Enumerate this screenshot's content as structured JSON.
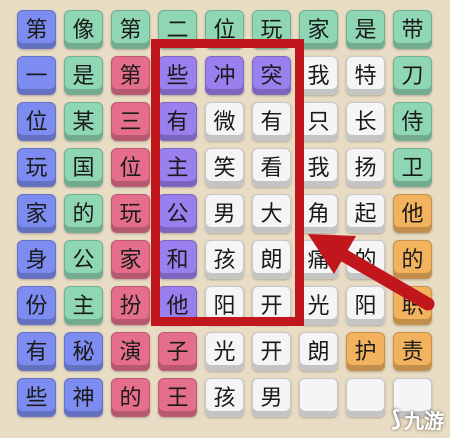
{
  "grid": {
    "rows": [
      [
        {
          "ch": "第",
          "color": "blue"
        },
        {
          "ch": "像",
          "color": "green"
        },
        {
          "ch": "第",
          "color": "green"
        },
        {
          "ch": "二",
          "color": "green"
        },
        {
          "ch": "位",
          "color": "green"
        },
        {
          "ch": "玩",
          "color": "green"
        },
        {
          "ch": "家",
          "color": "green"
        },
        {
          "ch": "是",
          "color": "green"
        },
        {
          "ch": "带",
          "color": "green"
        }
      ],
      [
        {
          "ch": "一",
          "color": "blue"
        },
        {
          "ch": "是",
          "color": "green"
        },
        {
          "ch": "第",
          "color": "pink"
        },
        {
          "ch": "些",
          "color": "purple"
        },
        {
          "ch": "冲",
          "color": "purple"
        },
        {
          "ch": "突",
          "color": "purple"
        },
        {
          "ch": "我",
          "color": "white"
        },
        {
          "ch": "特",
          "color": "white"
        },
        {
          "ch": "刀",
          "color": "green"
        }
      ],
      [
        {
          "ch": "位",
          "color": "blue"
        },
        {
          "ch": "某",
          "color": "green"
        },
        {
          "ch": "三",
          "color": "pink"
        },
        {
          "ch": "有",
          "color": "purple"
        },
        {
          "ch": "微",
          "color": "white"
        },
        {
          "ch": "有",
          "color": "white"
        },
        {
          "ch": "只",
          "color": "white"
        },
        {
          "ch": "长",
          "color": "white"
        },
        {
          "ch": "侍",
          "color": "green"
        }
      ],
      [
        {
          "ch": "玩",
          "color": "blue"
        },
        {
          "ch": "国",
          "color": "green"
        },
        {
          "ch": "位",
          "color": "pink"
        },
        {
          "ch": "主",
          "color": "purple"
        },
        {
          "ch": "笑",
          "color": "white"
        },
        {
          "ch": "看",
          "color": "white"
        },
        {
          "ch": "我",
          "color": "white"
        },
        {
          "ch": "扬",
          "color": "white"
        },
        {
          "ch": "卫",
          "color": "green"
        }
      ],
      [
        {
          "ch": "家",
          "color": "blue"
        },
        {
          "ch": "的",
          "color": "green"
        },
        {
          "ch": "玩",
          "color": "pink"
        },
        {
          "ch": "公",
          "color": "purple"
        },
        {
          "ch": "男",
          "color": "white"
        },
        {
          "ch": "大",
          "color": "white"
        },
        {
          "ch": "角",
          "color": "white"
        },
        {
          "ch": "起",
          "color": "white"
        },
        {
          "ch": "他",
          "color": "orange"
        }
      ],
      [
        {
          "ch": "身",
          "color": "blue"
        },
        {
          "ch": "公",
          "color": "green"
        },
        {
          "ch": "家",
          "color": "pink"
        },
        {
          "ch": "和",
          "color": "purple"
        },
        {
          "ch": "孩",
          "color": "white"
        },
        {
          "ch": "朗",
          "color": "white"
        },
        {
          "ch": "痛",
          "color": "white"
        },
        {
          "ch": "的",
          "color": "white"
        },
        {
          "ch": "的",
          "color": "orange"
        }
      ],
      [
        {
          "ch": "份",
          "color": "blue"
        },
        {
          "ch": "主",
          "color": "green"
        },
        {
          "ch": "扮",
          "color": "pink"
        },
        {
          "ch": "他",
          "color": "purple"
        },
        {
          "ch": "阳",
          "color": "white"
        },
        {
          "ch": "开",
          "color": "white"
        },
        {
          "ch": "光",
          "color": "white"
        },
        {
          "ch": "阳",
          "color": "white"
        },
        {
          "ch": "职",
          "color": "orange"
        }
      ],
      [
        {
          "ch": "有",
          "color": "blue"
        },
        {
          "ch": "秘",
          "color": "blue"
        },
        {
          "ch": "演",
          "color": "pink"
        },
        {
          "ch": "子",
          "color": "pink"
        },
        {
          "ch": "光",
          "color": "white"
        },
        {
          "ch": "开",
          "color": "white"
        },
        {
          "ch": "朗",
          "color": "white"
        },
        {
          "ch": "护",
          "color": "orange"
        },
        {
          "ch": "责",
          "color": "orange"
        }
      ],
      [
        {
          "ch": "些",
          "color": "blue"
        },
        {
          "ch": "神",
          "color": "blue"
        },
        {
          "ch": "的",
          "color": "pink"
        },
        {
          "ch": "王",
          "color": "pink"
        },
        {
          "ch": "孩",
          "color": "white"
        },
        {
          "ch": "男",
          "color": "white"
        },
        {
          "ch": "",
          "color": "white"
        },
        {
          "ch": "",
          "color": "white"
        },
        {
          "ch": "",
          "color": "white"
        }
      ]
    ]
  },
  "colors": {
    "highlight": "#c1161c",
    "arrow": "#c1161c"
  },
  "watermark": {
    "text": "九游",
    "mark_icon": "jiuyou-logo-icon"
  }
}
